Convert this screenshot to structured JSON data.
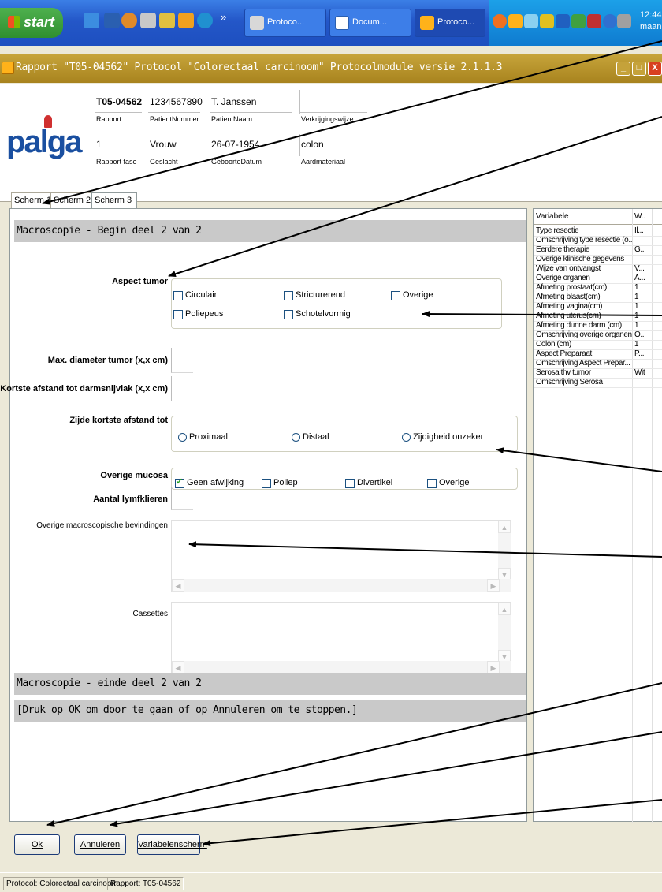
{
  "taskbar": {
    "start_label": "start",
    "tasks": [
      {
        "label": "Protoco...",
        "active": false
      },
      {
        "label": "Docum...",
        "active": false
      },
      {
        "label": "Protoco...",
        "active": true
      }
    ],
    "overflow": "»",
    "clock_time": "12:44",
    "clock_day": "maandag"
  },
  "window": {
    "title": "Rapport \"T05-04562\" Protocol \"Colorectaal carcinoom\"   Protocolmodule versie 2.1.1.3",
    "minimize": "_",
    "maximize": "□",
    "close": "X"
  },
  "header": {
    "logo_text": "palga",
    "report_number": "T05-04562",
    "report_label": "Rapport",
    "patient_number": "1234567890",
    "patient_number_label": "PatientNummer",
    "patient_name": "T. Janssen",
    "patient_name_label": "PatientNaam",
    "acquisition_value": "",
    "acquisition_label": "Verkrijgingswijze",
    "report_phase": "1",
    "report_phase_label": "Rapport fase",
    "gender": "Vrouw",
    "gender_label": "Geslacht",
    "birth_date": "26-07-1954",
    "birth_date_label": "GeboorteDatum",
    "material": "colon",
    "material_label": "Aardmateriaal"
  },
  "tabs": [
    {
      "label": "Scherm 1",
      "active": false
    },
    {
      "label": "Scherm 2",
      "active": false
    },
    {
      "label": "Scherm 3",
      "active": true
    }
  ],
  "form": {
    "section_start": "Macroscopie - Begin deel 2 van 2",
    "aspect_tumor": {
      "label": "Aspect tumor",
      "options": [
        {
          "label": "Circulair",
          "checked": false
        },
        {
          "label": "Stricturerend",
          "checked": false
        },
        {
          "label": "Overige",
          "checked": false
        },
        {
          "label": "Poliepeus",
          "checked": false
        },
        {
          "label": "Schotelvormig",
          "checked": false
        }
      ]
    },
    "max_diameter_label": "Max. diameter tumor (x,x cm)",
    "max_diameter_value": "",
    "shortest_distance_label": "Kortste afstand tot darmsnijvlak (x,x cm)",
    "shortest_distance_value": "",
    "side": {
      "label": "Zijde kortste afstand tot",
      "options": [
        {
          "label": "Proximaal",
          "selected": false
        },
        {
          "label": "Distaal",
          "selected": false
        },
        {
          "label": "Zijdigheid onzeker",
          "selected": false
        }
      ]
    },
    "mucosa": {
      "label": "Overige mucosa",
      "options": [
        {
          "label": "Geen afwijking",
          "checked": true
        },
        {
          "label": "Poliep",
          "checked": false
        },
        {
          "label": "Divertikel",
          "checked": false
        },
        {
          "label": "Overige",
          "checked": false
        }
      ]
    },
    "lymph_label": "Aantal lymfklieren",
    "lymph_value": "",
    "other_findings_label": "Overige macroscopische bevindingen",
    "other_findings_value": "",
    "cassettes_label": "Cassettes",
    "cassettes_value": "",
    "section_end": "Macroscopie - einde deel 2 van 2",
    "instruction": "[Druk op OK om door te gaan of op Annuleren om te stoppen.]"
  },
  "variables": {
    "col_name": "Variabele",
    "col_value": "W..",
    "rows": [
      {
        "name": "Type resectie",
        "value": "Il..."
      },
      {
        "name": "Omschrijving type resectie (o...",
        "value": ""
      },
      {
        "name": "Eerdere therapie",
        "value": "G..."
      },
      {
        "name": "Overige klinische gegevens",
        "value": ""
      },
      {
        "name": "Wijze van ontvangst",
        "value": "V..."
      },
      {
        "name": "Overige organen",
        "value": "A..."
      },
      {
        "name": "Afmeting prostaat(cm)",
        "value": "1"
      },
      {
        "name": "Afmeting blaast(cm)",
        "value": "1"
      },
      {
        "name": "Afmeting vagina(cm)",
        "value": "1"
      },
      {
        "name": "Afmeting uterus(cm)",
        "value": "1"
      },
      {
        "name": "Afmeting dunne darm (cm)",
        "value": "1"
      },
      {
        "name": "Omschrijving overige organen",
        "value": "O..."
      },
      {
        "name": "Colon (cm)",
        "value": "1"
      },
      {
        "name": "Aspect Preparaat",
        "value": "P..."
      },
      {
        "name": "Omschrijving Aspect Prepar...",
        "value": ""
      },
      {
        "name": "Serosa thv tumor",
        "value": "Wit"
      },
      {
        "name": "Omschrijving Serosa",
        "value": ""
      }
    ]
  },
  "buttons": {
    "ok": "Ok",
    "cancel": "Annuleren",
    "variables": "Variabelenscherm"
  },
  "status": {
    "protocol": "Protocol: Colorectaal carcinoom",
    "report": "Rapport: T05-04562"
  },
  "colors": {
    "title_bar": "#b8952c",
    "section_bar": "#c9c9c9",
    "taskbar": "#2457c8",
    "annotation_arrow": "#000000"
  }
}
